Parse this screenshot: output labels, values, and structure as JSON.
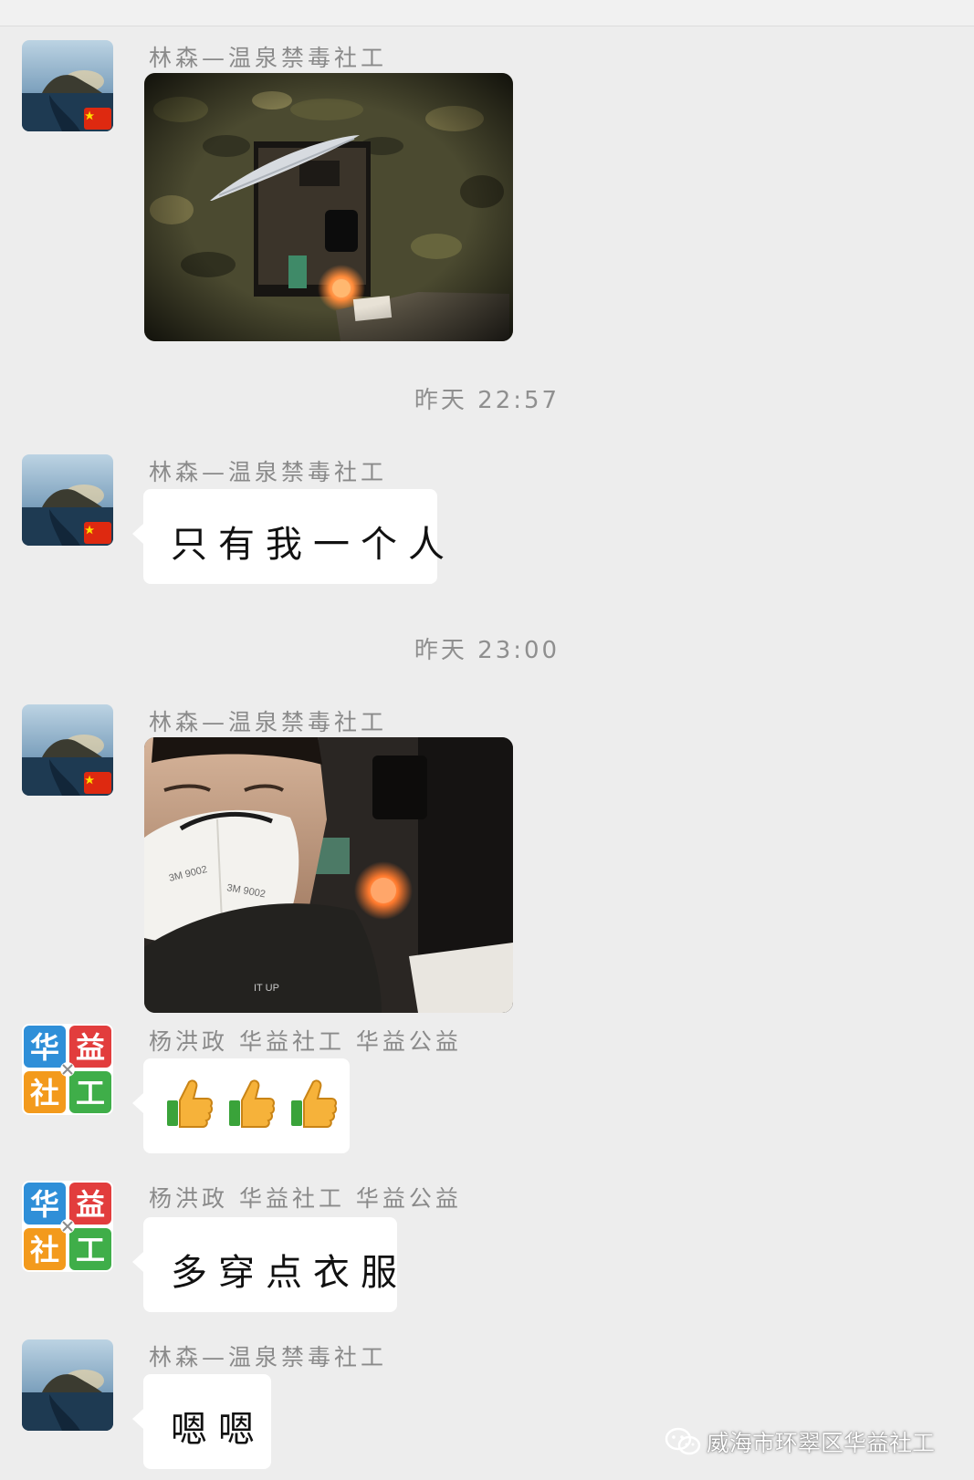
{
  "messages": [
    {
      "sender": "林森—温泉禁毒社工",
      "type": "image",
      "image_desc": "tent-interior-photo"
    },
    {
      "timestamp": "昨天 22:57"
    },
    {
      "sender": "林森—温泉禁毒社工",
      "type": "text",
      "text": "只有我一个人"
    },
    {
      "timestamp": "昨天 23:00"
    },
    {
      "sender": "林森—温泉禁毒社工",
      "type": "image",
      "image_desc": "selfie-photo"
    },
    {
      "sender": "杨洪政 华益社工 华益公益",
      "type": "emoji",
      "emoji": "thumbs-up",
      "count": 3
    },
    {
      "sender": "杨洪政 华益社工 华益公益",
      "type": "text",
      "text": "多穿点衣服"
    },
    {
      "sender": "林森—温泉禁毒社工",
      "type": "text",
      "text": "嗯嗯"
    }
  ],
  "avatar_badge": "CN-flag",
  "logo_avatar_text": [
    "华",
    "益",
    "社",
    "工"
  ],
  "watermark": {
    "text": "威海市环翠区华益社工",
    "icon": "wechat-icon"
  },
  "colors": {
    "background": "#ededed",
    "bubble": "#ffffff",
    "meta_text": "#8a8a8a",
    "logo_blue": "#2f8fd8",
    "logo_red": "#e23d3d",
    "logo_orange": "#f39a1c",
    "logo_green": "#3fae49"
  }
}
